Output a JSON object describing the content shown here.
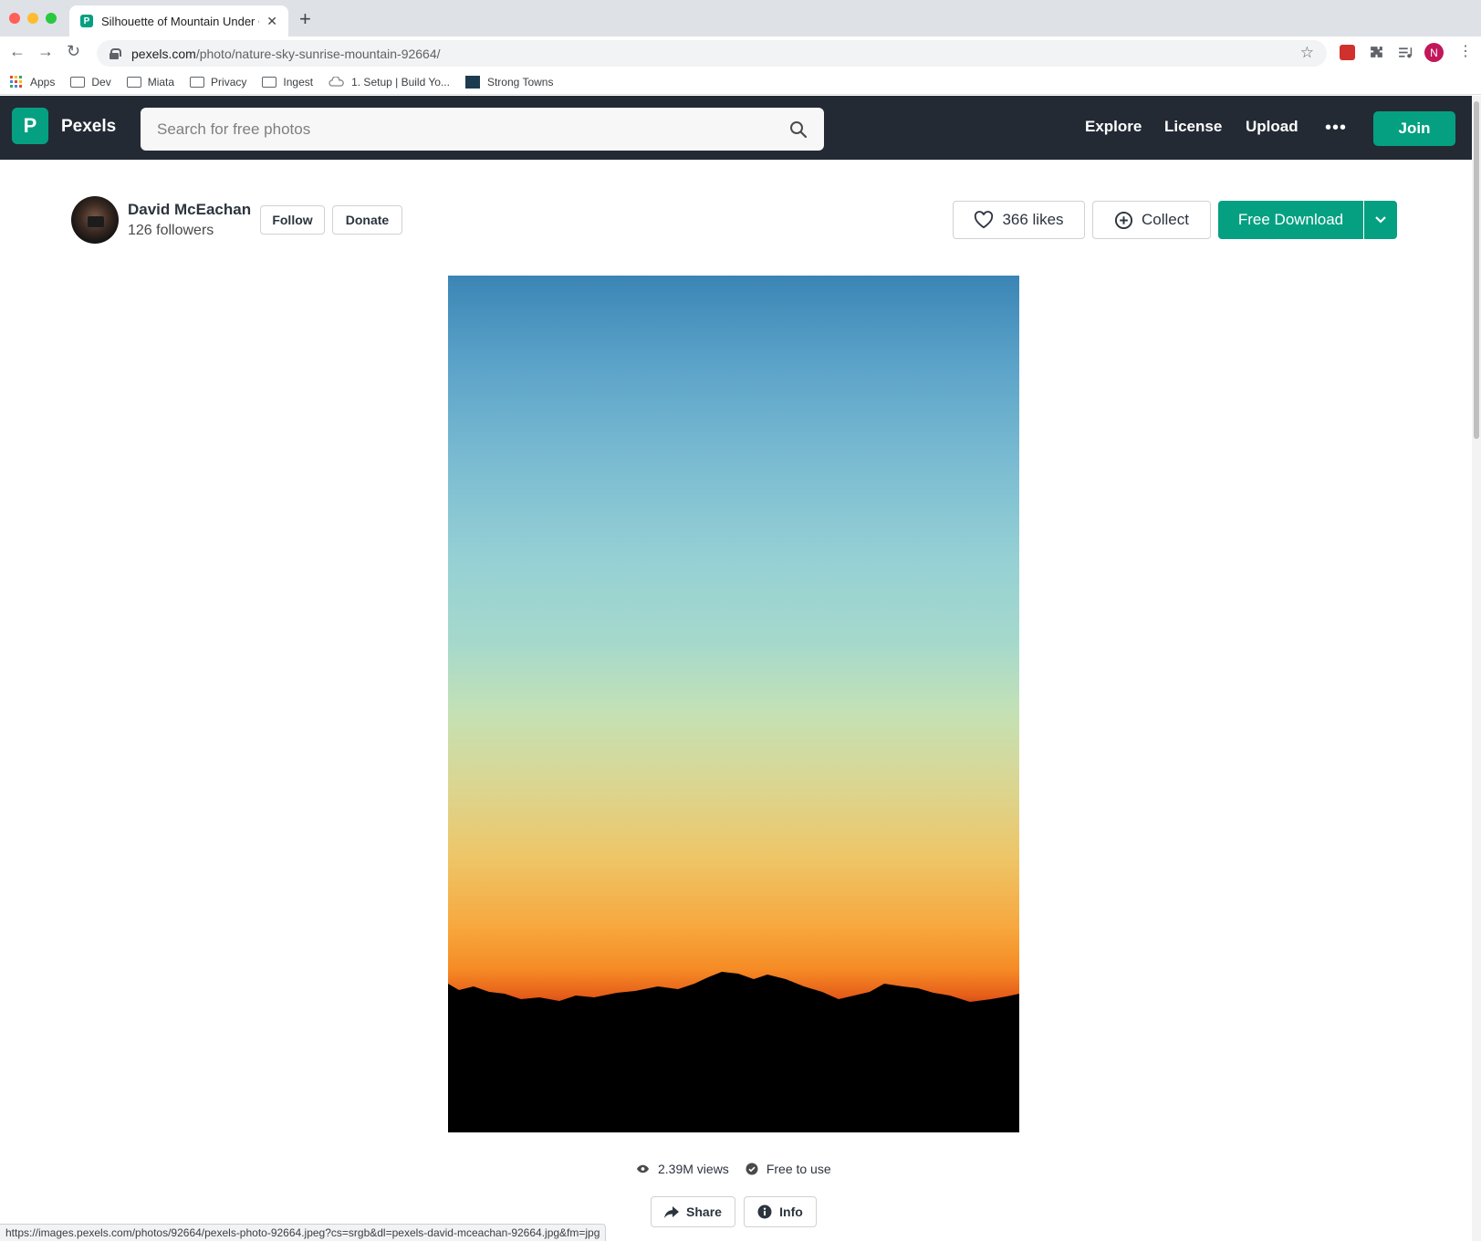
{
  "browser": {
    "tab_title": "Silhouette of Mountain Under C",
    "url_host": "pexels.com",
    "url_path": "/photo/nature-sky-sunrise-mountain-92664/",
    "profile_initial": "N",
    "bookmarks": [
      {
        "label": "Apps",
        "icon": "apps-grid-icon"
      },
      {
        "label": "Dev",
        "icon": "folder-icon"
      },
      {
        "label": "Miata",
        "icon": "folder-icon"
      },
      {
        "label": "Privacy",
        "icon": "folder-icon"
      },
      {
        "label": "Ingest",
        "icon": "folder-icon"
      },
      {
        "label": "1. Setup | Build Yo...",
        "icon": "cloud-icon"
      },
      {
        "label": "Strong Towns",
        "icon": "site-icon"
      }
    ],
    "status_url": "https://images.pexels.com/photos/92664/pexels-photo-92664.jpeg?cs=srgb&dl=pexels-david-mceachan-92664.jpg&fm=jpg"
  },
  "header": {
    "logo_letter": "P",
    "brand": "Pexels",
    "search_placeholder": "Search for free photos",
    "nav": [
      "Explore",
      "License",
      "Upload"
    ],
    "join_label": "Join",
    "colors": {
      "header_bg": "#232a34",
      "accent": "#05a081"
    }
  },
  "author": {
    "name": "David McEachan",
    "followers": "126 followers",
    "follow_label": "Follow",
    "donate_label": "Donate"
  },
  "actions": {
    "likes_label": "366 likes",
    "collect_label": "Collect",
    "download_label": "Free Download"
  },
  "stats": {
    "views": "2.39M views",
    "license": "Free to use"
  },
  "footer_actions": {
    "share_label": "Share",
    "info_label": "Info"
  }
}
